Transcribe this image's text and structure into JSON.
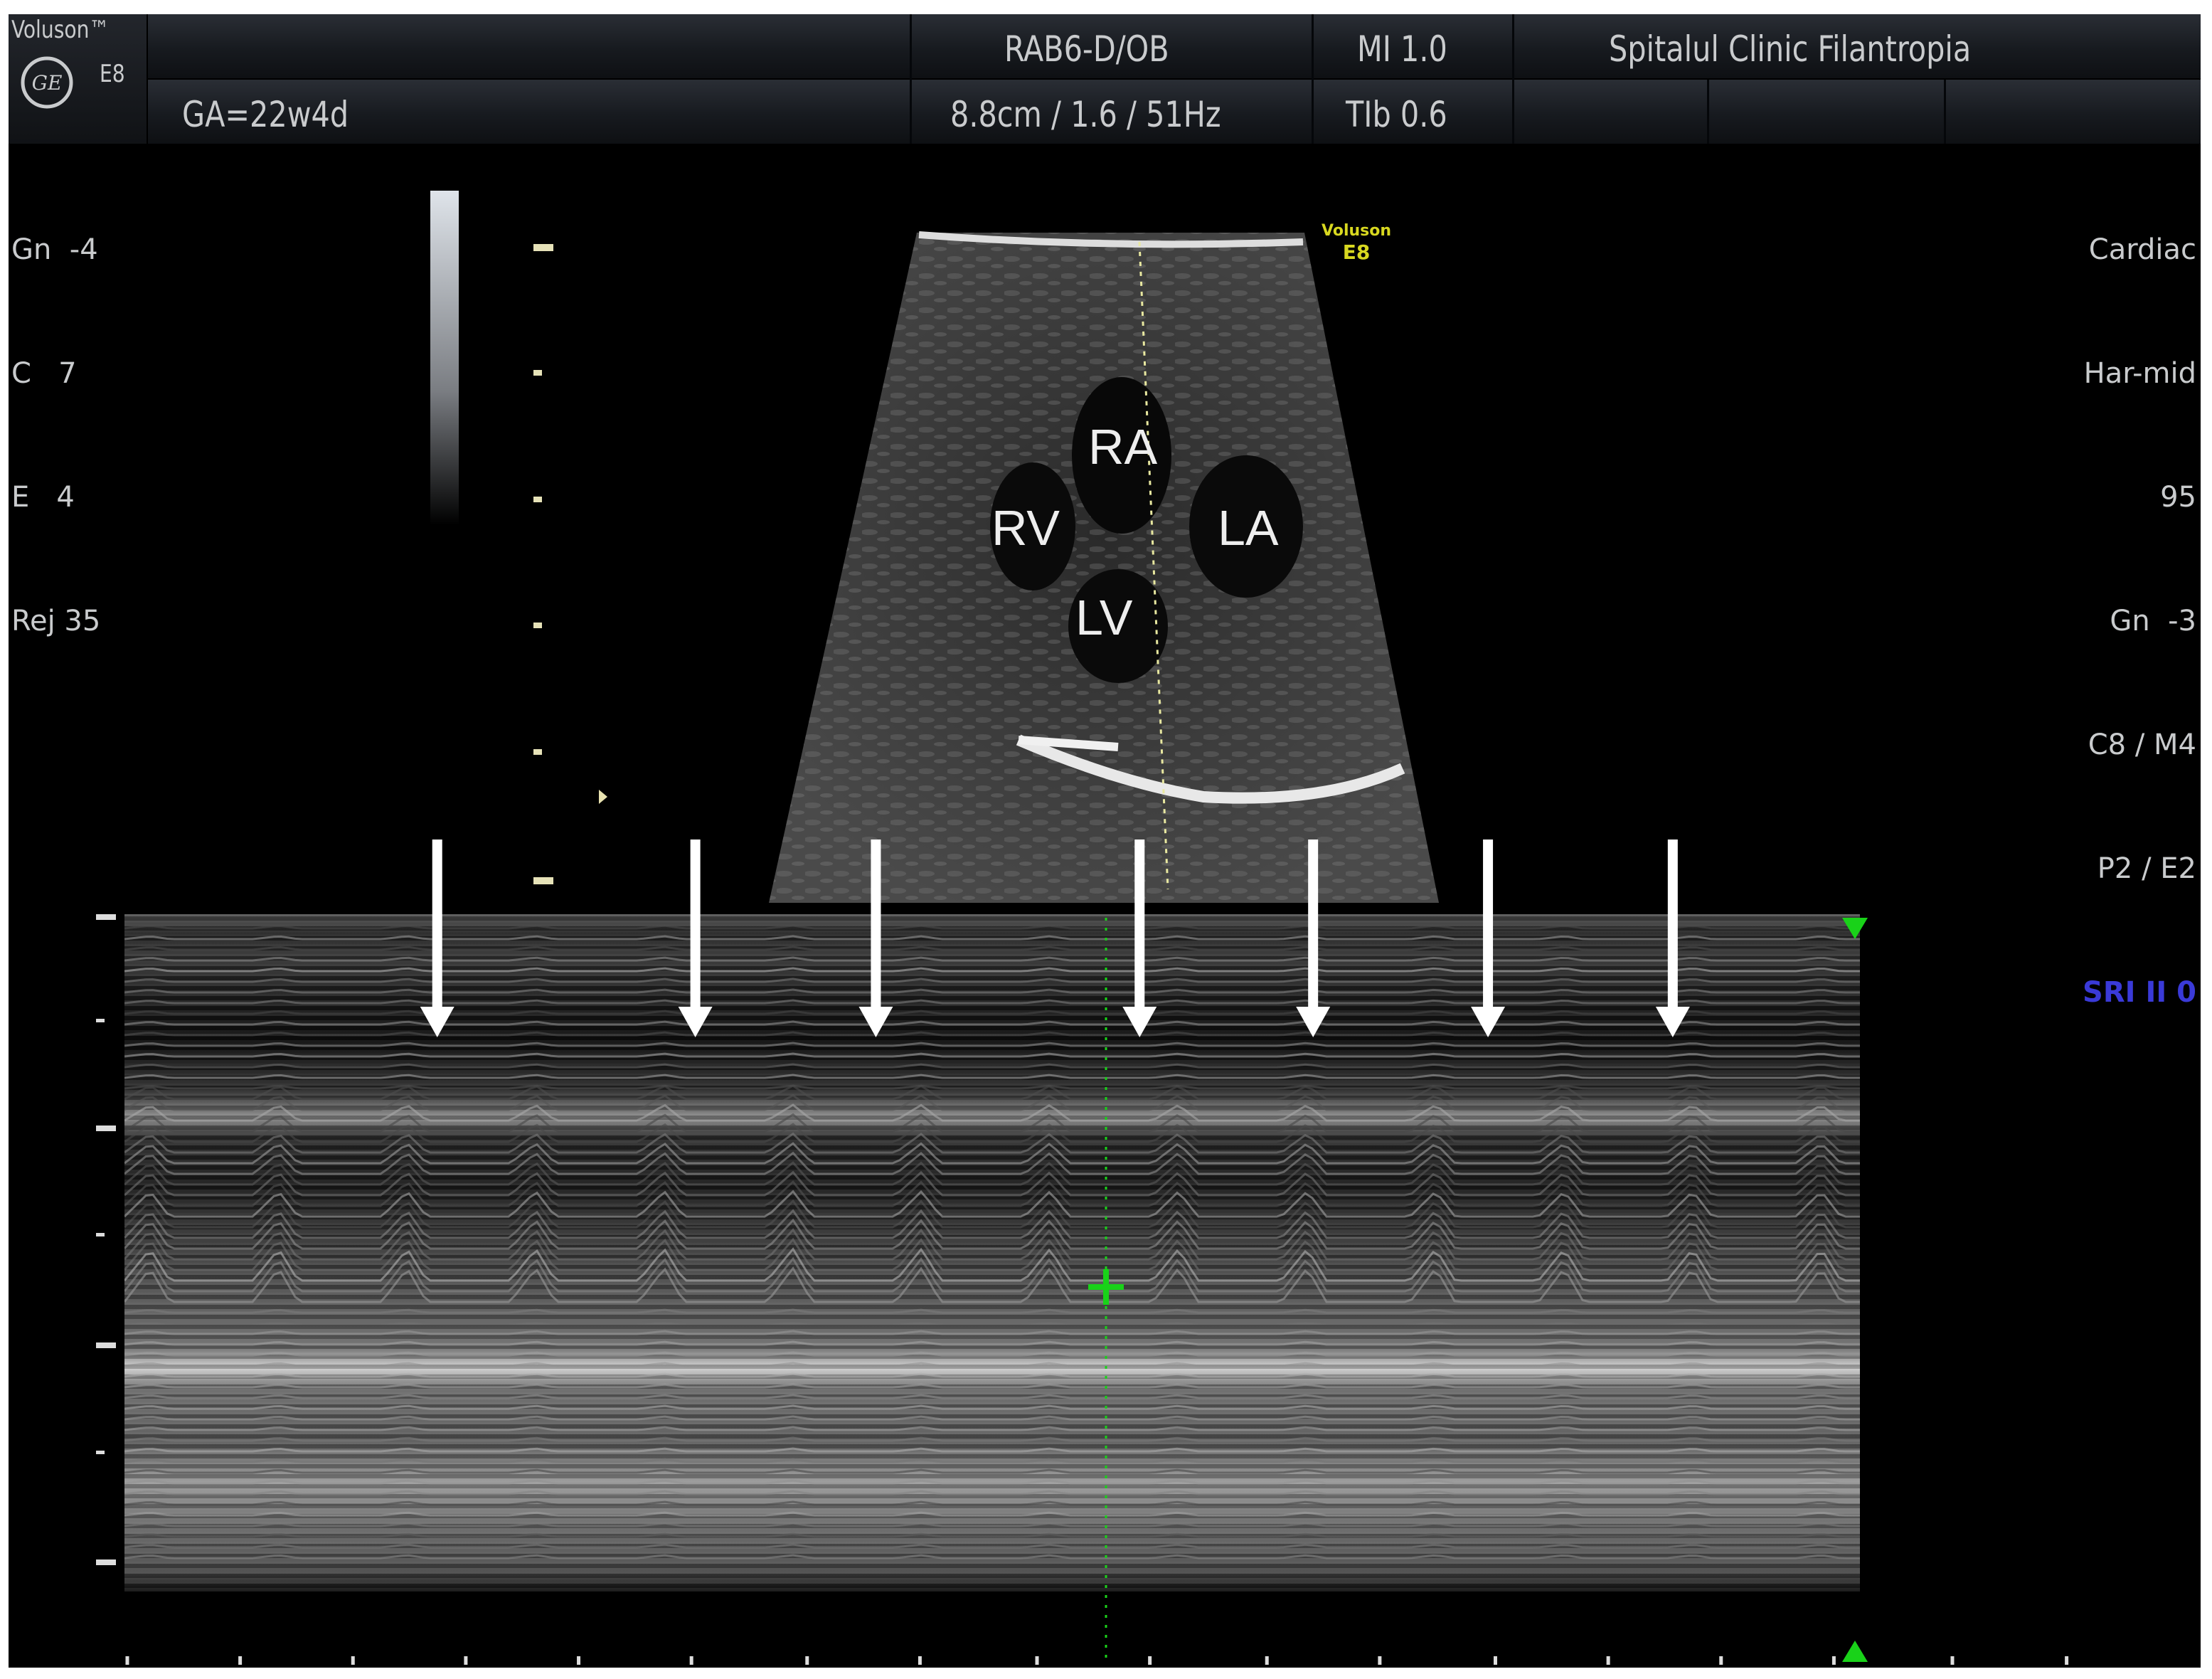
{
  "logo": {
    "brand": "Voluson™",
    "model": "E8",
    "emblem": "GE"
  },
  "header": {
    "patient_field": "",
    "ga": "GA=22w4d",
    "probe": "RAB6-D/OB",
    "depth_info": "8.8cm / 1.6 / 51Hz",
    "mi": "MI 1.0",
    "tib": "TIb 0.6",
    "institution": "Spitalul Clinic Filantropia"
  },
  "left_params": [
    "Gn  -4",
    "C   7",
    "E   4",
    "Rej 35"
  ],
  "right_params": [
    "Cardiac",
    "Har-mid",
    "95",
    "Gn  -3",
    "C8 / M4",
    "P2 / E2"
  ],
  "sri": {
    "text": "SRI II 0",
    "color": "#3a3ad8"
  },
  "image_watermark": {
    "brand": "Voluson",
    "model": "E8",
    "color": "#d8d820"
  },
  "chamber_labels": {
    "ra": "RA",
    "rv": "RV",
    "la": "LA",
    "lv": "LV"
  },
  "colors": {
    "marker_green": "#19d219",
    "cursor_yellow": "#e8e8a0",
    "arrow": "#ffffff"
  }
}
